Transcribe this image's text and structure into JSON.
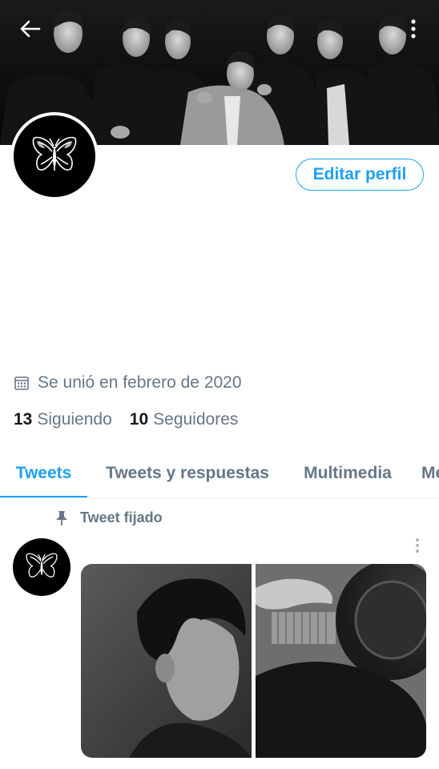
{
  "header": {
    "back_icon": "arrow-left-icon",
    "more_icon": "more-vertical-icon"
  },
  "profile": {
    "edit_button_label": "Editar perfil",
    "joined": "Se unió en febrero de 2020",
    "joined_icon": "calendar-icon",
    "following_count": "13",
    "following_label": "Siguiendo",
    "followers_count": "10",
    "followers_label": "Seguidores"
  },
  "tabs": [
    {
      "label": "Tweets",
      "active": true
    },
    {
      "label": "Tweets y respuestas",
      "active": false
    },
    {
      "label": "Multimedia",
      "active": false
    },
    {
      "label": "Me",
      "active": false
    }
  ],
  "pinned": {
    "label": "Tweet fijado",
    "icon": "pin-icon"
  },
  "colors": {
    "accent": "#1da1f2",
    "secondary_text": "#657786",
    "primary_text": "#14171a",
    "divider": "#e6ecf0"
  }
}
